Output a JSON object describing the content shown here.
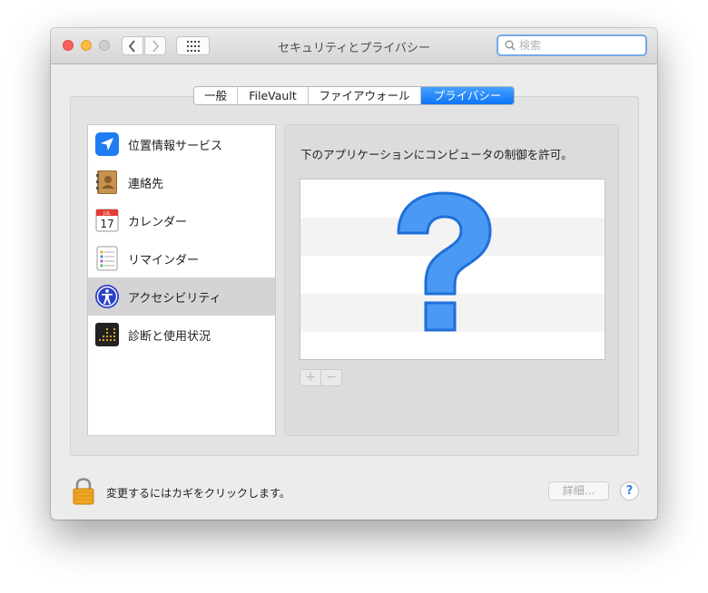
{
  "window": {
    "title": "セキュリティとプライバシー"
  },
  "search": {
    "placeholder": "検索",
    "value": ""
  },
  "tabs": [
    {
      "label": "一般",
      "active": false
    },
    {
      "label": "FileVault",
      "active": false
    },
    {
      "label": "ファイアウォール",
      "active": false
    },
    {
      "label": "プライバシー",
      "active": true
    }
  ],
  "sidebar": {
    "items": [
      {
        "label": "位置情報サービス",
        "icon": "location-arrow-icon",
        "selected": false
      },
      {
        "label": "連絡先",
        "icon": "contacts-book-icon",
        "selected": false
      },
      {
        "label": "カレンダー",
        "icon": "calendar-icon",
        "selected": false
      },
      {
        "label": "リマインダー",
        "icon": "reminders-icon",
        "selected": false
      },
      {
        "label": "アクセシビリティ",
        "icon": "accessibility-icon",
        "selected": true
      },
      {
        "label": "診断と使用状況",
        "icon": "diagnostics-icon",
        "selected": false
      }
    ]
  },
  "calendar_icon": {
    "month": "JUL",
    "day": "17"
  },
  "main": {
    "description": "下のアプリケーションにコンピュータの制御を許可。",
    "add_label": "+",
    "remove_label": "−",
    "placeholder_icon": "question-mark-icon"
  },
  "footer": {
    "lock_text": "変更するにはカギをクリックします。",
    "advanced_label": "詳細...",
    "help_label": "?"
  },
  "colors": {
    "accent": "#1a7ef8",
    "close": "#fc615d",
    "minimize": "#fdbc40",
    "question": "#4a9af5"
  }
}
